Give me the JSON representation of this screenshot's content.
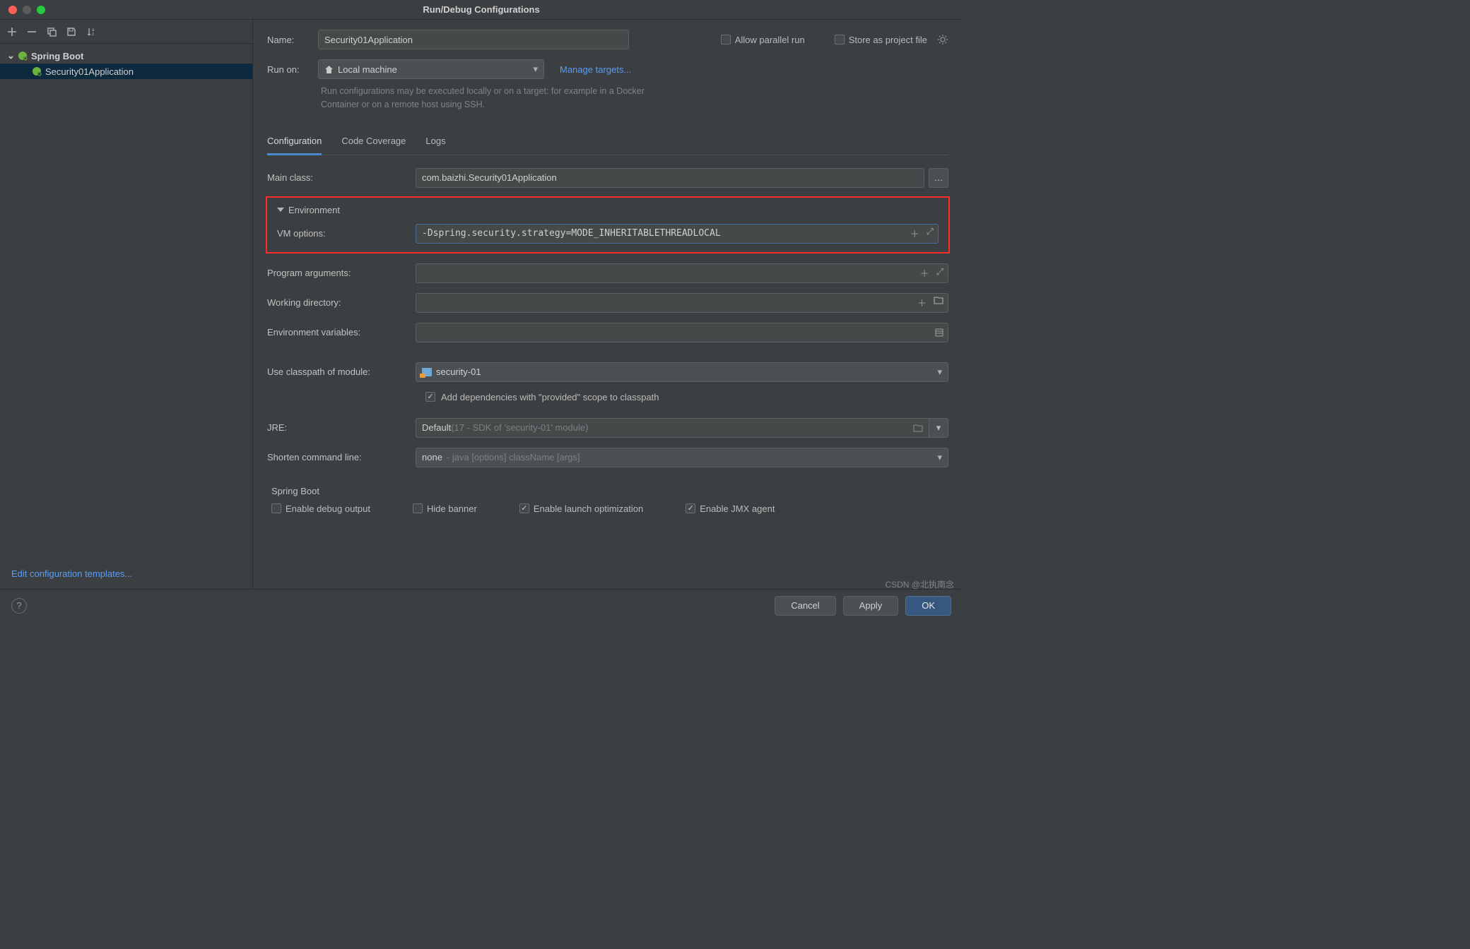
{
  "window": {
    "title": "Run/Debug Configurations"
  },
  "tree": {
    "root": "Spring Boot",
    "item": "Security01Application"
  },
  "left_footer": {
    "edit_templates": "Edit configuration templates..."
  },
  "header": {
    "name_label": "Name:",
    "name_value": "Security01Application",
    "allow_parallel": "Allow parallel run",
    "store_project": "Store as project file"
  },
  "runon": {
    "label": "Run on:",
    "value": "Local machine",
    "manage": "Manage targets...",
    "hint": "Run configurations may be executed locally or on a target: for example in a Docker Container or on a remote host using SSH."
  },
  "tabs": {
    "config": "Configuration",
    "coverage": "Code Coverage",
    "logs": "Logs"
  },
  "form": {
    "main_class_label": "Main class:",
    "main_class_value": "com.baizhi.Security01Application",
    "env_section": "Environment",
    "vm_label": "VM options:",
    "vm_value": "-Dspring.security.strategy=MODE_INHERITABLETHREADLOCAL",
    "prog_args_label": "Program arguments:",
    "workdir_label": "Working directory:",
    "envvars_label": "Environment variables:",
    "classpath_label": "Use classpath of module:",
    "classpath_value": "security-01",
    "provided_scope": "Add dependencies with \"provided\" scope to classpath",
    "jre_label": "JRE:",
    "jre_value": "Default",
    "jre_detail": " (17 - SDK of 'security-01' module)",
    "shorten_label": "Shorten command line:",
    "shorten_value": "none",
    "shorten_detail": " - java [options] className [args]",
    "boot_section": "Spring Boot",
    "enable_debug": "Enable debug output",
    "hide_banner": "Hide banner",
    "launch_opt": "Enable launch optimization",
    "jmx_agent": "Enable JMX agent"
  },
  "footer": {
    "cancel": "Cancel",
    "apply": "Apply",
    "ok": "OK"
  },
  "watermark": "CSDN @北执南念"
}
